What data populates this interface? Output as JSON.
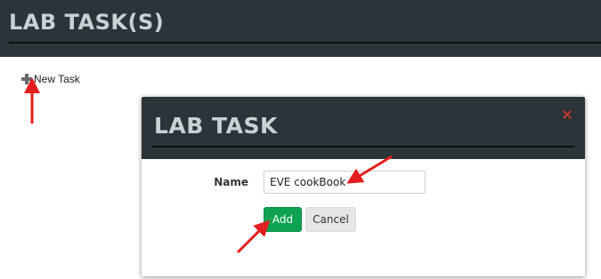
{
  "page": {
    "title": "LAB TASK(S)",
    "new_task_label": "New Task"
  },
  "modal": {
    "title": "LAB TASK",
    "name_label": "Name",
    "name_value": "EVE cookBook",
    "add_label": "Add",
    "cancel_label": "Cancel"
  },
  "icons": {
    "new_task": "plus-icon",
    "close": "close-icon"
  },
  "colors": {
    "header_bg": "#2b3438",
    "header_text": "#c9d1d5",
    "add_button": "#0ea352",
    "close_icon": "#c0392b",
    "annotation_arrow": "#e31e1e"
  }
}
